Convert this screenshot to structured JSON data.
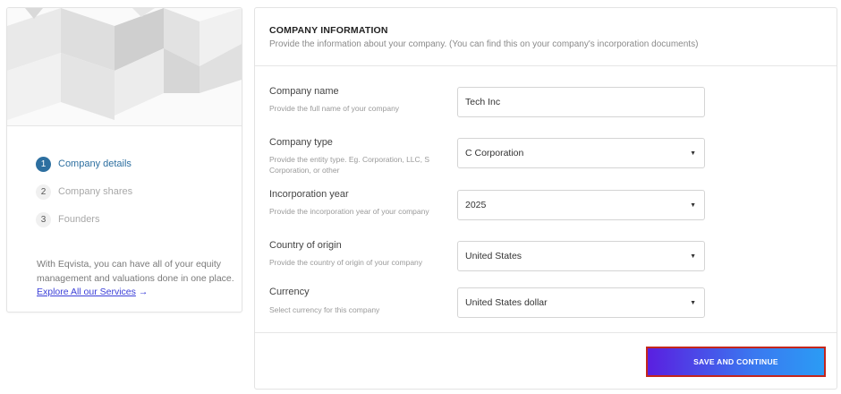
{
  "steps": [
    {
      "number": "1",
      "label": "Company details",
      "state": "active"
    },
    {
      "number": "2",
      "label": "Company shares",
      "state": "inactive"
    },
    {
      "number": "3",
      "label": "Founders",
      "state": "inactive"
    }
  ],
  "promo": {
    "text": "With Eqvista, you can have all of your equity management and valuations done in one place.",
    "link_label": "Explore All our Services",
    "arrow": "→"
  },
  "section": {
    "title": "COMPANY INFORMATION",
    "subtitle": "Provide the information about your company. (You can find this on your company's incorporation documents)"
  },
  "fields": {
    "company_name": {
      "label": "Company name",
      "help": "Provide the full name of your company",
      "value": "Tech Inc"
    },
    "company_type": {
      "label": "Company type",
      "help": "Provide the entity type. Eg. Corporation, LLC, S Corporation, or other",
      "value": "C Corporation"
    },
    "incorporation_year": {
      "label": "Incorporation year",
      "help": "Provide the incorporation year of your company",
      "value": "2025"
    },
    "country_of_origin": {
      "label": "Country of origin",
      "help": "Provide the country of origin of your company",
      "value": "United States"
    },
    "currency": {
      "label": "Currency",
      "help": "Select currency for this company",
      "value": "United States dollar"
    }
  },
  "actions": {
    "save_label": "SAVE AND CONTINUE"
  },
  "colors": {
    "accent": "#2d6fa0",
    "link": "#3b3fd8",
    "button_start": "#5a1fe0",
    "button_end": "#2b9cf5",
    "button_outline": "#c4261c"
  },
  "icons": {
    "dropdown": "caret-down-icon",
    "arrow": "arrow-right-icon"
  }
}
